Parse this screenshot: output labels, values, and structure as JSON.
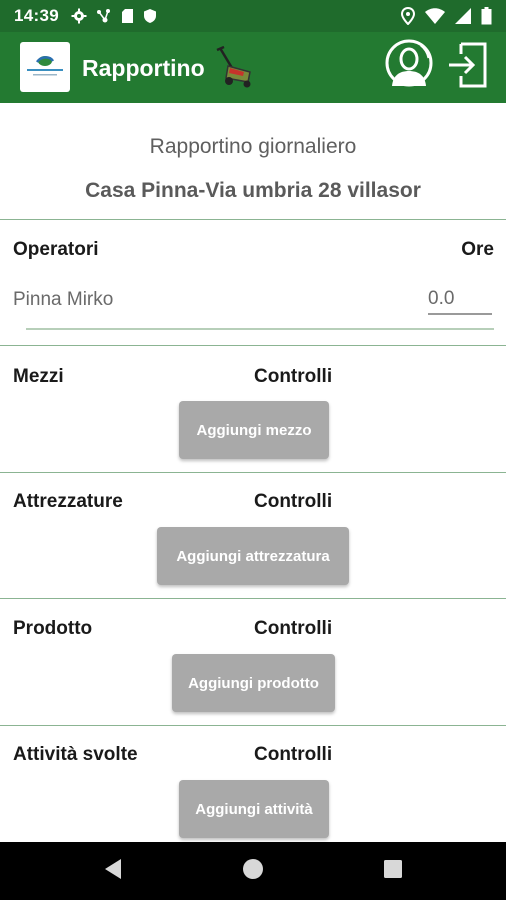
{
  "status_bar": {
    "time": "14:39",
    "left_icons": [
      "gear-icon",
      "hub-icon",
      "sd-card-icon",
      "shield-icon"
    ],
    "right_icons": [
      "location-icon",
      "wifi-icon",
      "signal-icon",
      "battery-icon"
    ]
  },
  "app_bar": {
    "title": "Rapportino",
    "logo_icon": "company-logo",
    "mower_icon": "lawn-mower-icon",
    "user_icon": "user-profile-icon",
    "logout_icon": "logout-icon"
  },
  "report": {
    "subtitle": "Rapportino giornaliero",
    "location": "Casa Pinna-Via umbria 28 villasor"
  },
  "operators": {
    "header": "Operatori",
    "hours_header": "Ore",
    "rows": [
      {
        "name": "Pinna Mirko",
        "hours": "0.0"
      }
    ]
  },
  "sections": [
    {
      "label": "Mezzi",
      "controls_label": "Controlli",
      "button_label": "Aggiungi mezzo"
    },
    {
      "label": "Attrezzature",
      "controls_label": "Controlli",
      "button_label": "Aggiungi attrezzatura"
    },
    {
      "label": "Prodotto",
      "controls_label": "Controlli",
      "button_label": "Aggiungi prodotto"
    },
    {
      "label": "Attività svolte",
      "controls_label": "Controlli",
      "button_label": "Aggiungi attività"
    }
  ],
  "nav_bar": {
    "icons": [
      "back-icon",
      "home-icon",
      "recents-icon"
    ]
  },
  "colors": {
    "status_bar": "#1f6b2c",
    "app_bar": "#237a31",
    "divider": "#8bb492",
    "button": "#a9a9a9"
  }
}
